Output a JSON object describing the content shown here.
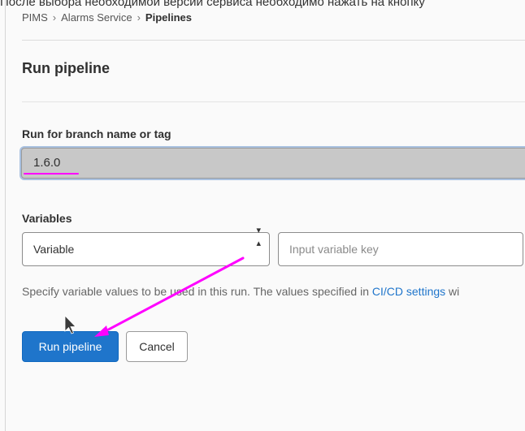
{
  "caption": "После выбора необходимой версии сервиса необходимо нажать на кнопку",
  "breadcrumb": {
    "items": [
      "PIMS",
      "Alarms Service"
    ],
    "current": "Pipelines",
    "separator": "›"
  },
  "page": {
    "title": "Run pipeline"
  },
  "branch": {
    "label": "Run for branch name or tag",
    "value": "1.6.0"
  },
  "variables": {
    "label": "Variables",
    "type_value": "Variable",
    "type_icon": "sort-arrows-icon",
    "key_placeholder": "Input variable key"
  },
  "help": {
    "text": "Specify variable values to be used in this run. The values specified in ",
    "link": "CI/CD settings",
    "suffix": " wi"
  },
  "actions": {
    "run_label": "Run pipeline",
    "cancel_label": "Cancel"
  },
  "annotation": {
    "color": "#ff00ff"
  }
}
